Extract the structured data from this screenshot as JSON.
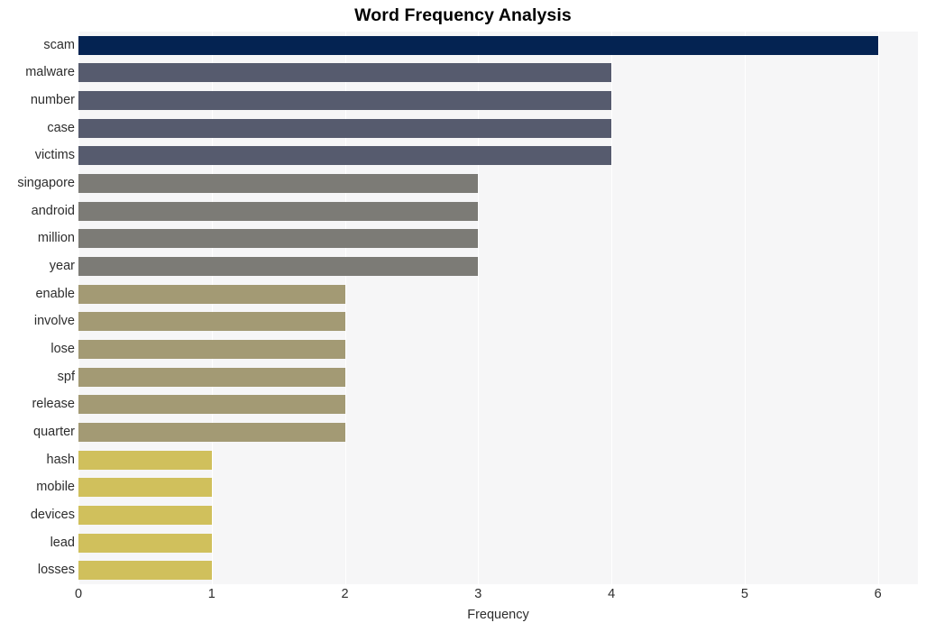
{
  "chart_data": {
    "type": "bar",
    "orientation": "horizontal",
    "title": "Word Frequency Analysis",
    "xlabel": "Frequency",
    "ylabel": "",
    "xlim": [
      0,
      6.3
    ],
    "xticks": [
      0,
      1,
      2,
      3,
      4,
      5,
      6
    ],
    "xtick_labels": [
      "0",
      "1",
      "2",
      "3",
      "4",
      "5",
      "6"
    ],
    "grid": "vertical",
    "legend": "none",
    "categories": [
      "scam",
      "malware",
      "number",
      "case",
      "victims",
      "singapore",
      "android",
      "million",
      "year",
      "enable",
      "involve",
      "lose",
      "spf",
      "release",
      "quarter",
      "hash",
      "mobile",
      "devices",
      "lead",
      "losses"
    ],
    "values": [
      6,
      4,
      4,
      4,
      4,
      3,
      3,
      3,
      3,
      2,
      2,
      2,
      2,
      2,
      2,
      1,
      1,
      1,
      1,
      1
    ],
    "bar_colors": [
      "#042352",
      "#565b6e",
      "#565b6e",
      "#565b6e",
      "#565b6e",
      "#7c7b76",
      "#7c7b76",
      "#7c7b76",
      "#7c7b76",
      "#a39a74",
      "#a39a74",
      "#a39a74",
      "#a39a74",
      "#a39a74",
      "#a39a74",
      "#d0c05c",
      "#d0c05c",
      "#d0c05c",
      "#d0c05c",
      "#d0c05c"
    ],
    "colors": {
      "plot_background": "#f6f6f7",
      "figure_background": "#ffffff",
      "gridline": "#ffffff",
      "text": "#2d2d2d",
      "title": "#000000"
    }
  }
}
